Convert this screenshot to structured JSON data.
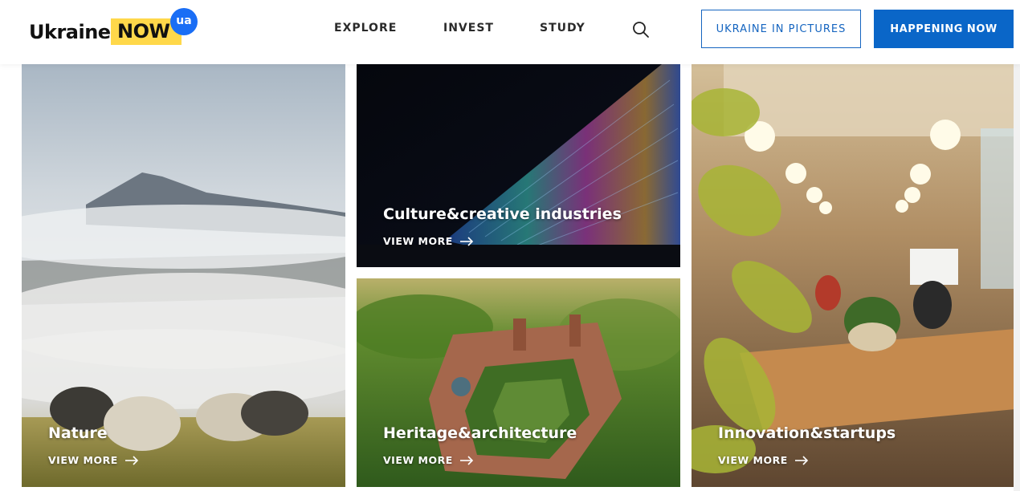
{
  "header": {
    "logo": {
      "word": "Ukraine",
      "highlight": "NOW",
      "badge": "ua"
    },
    "nav": [
      {
        "label": "EXPLORE"
      },
      {
        "label": "INVEST"
      },
      {
        "label": "STUDY"
      }
    ],
    "search_icon": "search-icon",
    "outline_button": "UKRAINE IN PICTURES",
    "solid_button": "HAPPENING NOW"
  },
  "tiles": [
    {
      "title": "Nature",
      "link": "VIEW MORE"
    },
    {
      "title": "Culture&creative industries",
      "link": "VIEW MORE"
    },
    {
      "title": "Heritage&architecture",
      "link": "VIEW MORE"
    },
    {
      "title": "Innovation&startups",
      "link": "VIEW MORE"
    }
  ],
  "colors": {
    "brand_blue": "#0a66c8",
    "logo_yellow": "#ffd84a",
    "badge_blue": "#1a6ef5"
  }
}
